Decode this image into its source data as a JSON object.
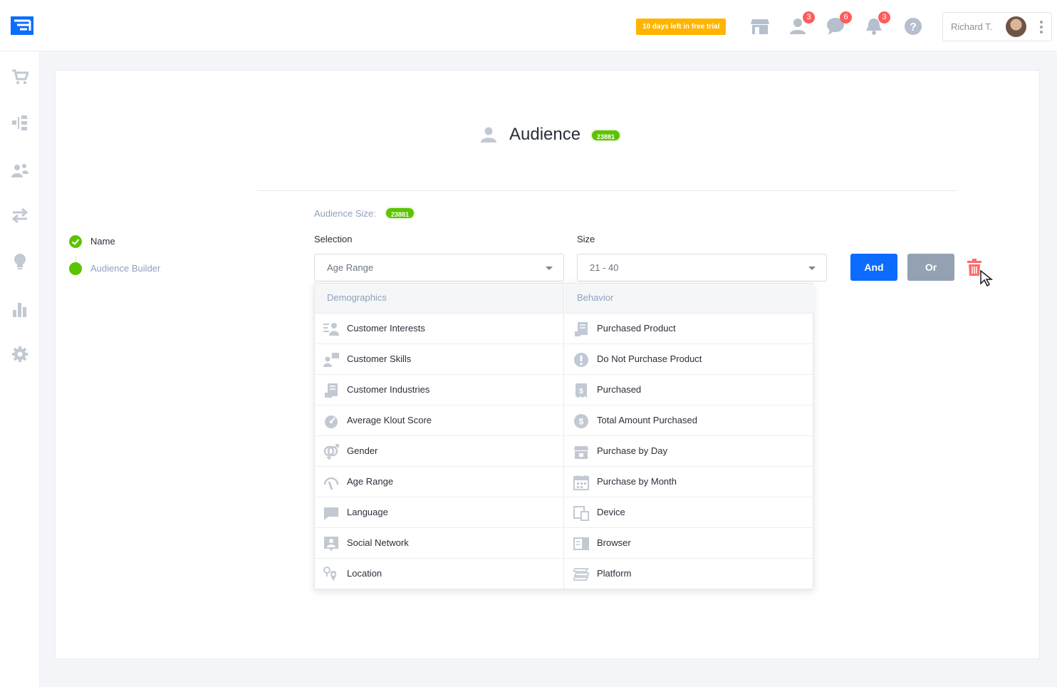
{
  "topbar": {
    "trial_text": "10 days left in free trial",
    "badges": {
      "users": "3",
      "messages": "6",
      "notifications": "3"
    },
    "user_name": "Richard T."
  },
  "page": {
    "title": "Audience",
    "count": "23881"
  },
  "stepper": {
    "steps": [
      {
        "label": "Name",
        "state": "done"
      },
      {
        "label": "Audience Builder",
        "state": "active"
      }
    ]
  },
  "builder": {
    "size_label": "Audience Size:",
    "size_value": "23881",
    "selection_label": "Selection",
    "selection_value": "Age Range",
    "size_field_label": "Size",
    "size_field_value": "21 - 40",
    "and_label": "And",
    "or_label": "Or"
  },
  "dropdown": {
    "demographics": {
      "header": "Demographics",
      "items": [
        {
          "label": "Customer Interests",
          "icon": "interests-icon"
        },
        {
          "label": "Customer Skills",
          "icon": "skills-icon"
        },
        {
          "label": "Customer Industries",
          "icon": "industries-icon"
        },
        {
          "label": "Average Klout Score",
          "icon": "klout-icon"
        },
        {
          "label": "Gender",
          "icon": "gender-icon"
        },
        {
          "label": "Age Range",
          "icon": "age-icon"
        },
        {
          "label": "Language",
          "icon": "chat-icon"
        },
        {
          "label": "Social Network",
          "icon": "social-icon"
        },
        {
          "label": "Location",
          "icon": "location-icon"
        }
      ]
    },
    "behavior": {
      "header": "Behavior",
      "items": [
        {
          "label": "Purchased Product",
          "icon": "product-icon"
        },
        {
          "label": "Do Not Purchase Product",
          "icon": "alert-icon"
        },
        {
          "label": "Purchased",
          "icon": "receipt-icon"
        },
        {
          "label": "Total Amount Purchased",
          "icon": "dollar-icon"
        },
        {
          "label": "Purchase by Day",
          "icon": "store-icon"
        },
        {
          "label": "Purchase by Month",
          "icon": "calendar-icon"
        },
        {
          "label": "Device",
          "icon": "device-icon"
        },
        {
          "label": "Browser",
          "icon": "browser-icon"
        },
        {
          "label": "Platform",
          "icon": "platform-icon"
        }
      ]
    }
  },
  "colors": {
    "primary": "#0b6cff",
    "success": "#5cc300",
    "warning": "#ffb400",
    "danger": "#ff5c5c",
    "muted": "#93a1b3"
  }
}
